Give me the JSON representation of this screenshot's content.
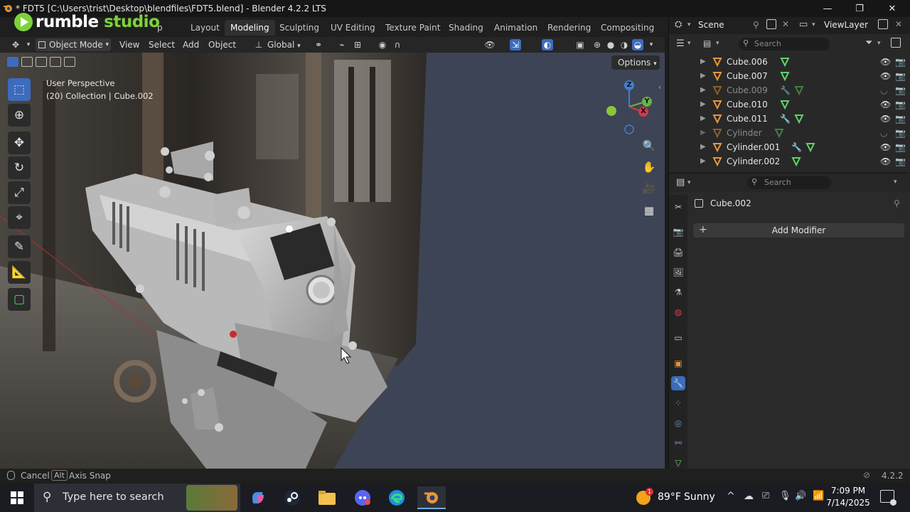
{
  "window": {
    "title": "* FDT5 [C:\\Users\\trist\\Desktop\\blendfiles\\FDT5.blend] - Blender 4.2.2 LTS",
    "minimize": "—",
    "maximize": "❐",
    "close": "✕"
  },
  "watermark": {
    "brand": "rumble",
    "suffix": "studio",
    "hidden_tab": "p"
  },
  "workspaces": [
    {
      "label": "Layout",
      "active": false
    },
    {
      "label": "Modeling",
      "active": true
    },
    {
      "label": "Sculpting",
      "active": false
    },
    {
      "label": "UV Editing",
      "active": false
    },
    {
      "label": "Texture Paint",
      "active": false
    },
    {
      "label": "Shading",
      "active": false
    },
    {
      "label": "Animation",
      "active": false
    },
    {
      "label": "Rendering",
      "active": false
    },
    {
      "label": "Compositing",
      "active": false
    }
  ],
  "scene": {
    "label": "Scene",
    "view_layer": "ViewLayer"
  },
  "viewport_header": {
    "mode": "Object Mode",
    "menus": [
      "View",
      "Select",
      "Add",
      "Object"
    ],
    "transform_orientation": "Global",
    "options_label": "Options"
  },
  "viewport": {
    "perspective": "User Perspective",
    "collection": "(20) Collection | Cube.002",
    "gizmo": {
      "x": "X",
      "y": "Y",
      "z": "Z"
    }
  },
  "outliner": {
    "search_placeholder": "Search",
    "rows": [
      {
        "name": "Cube.006",
        "dim": false,
        "visible": true
      },
      {
        "name": "Cube.007",
        "dim": false,
        "visible": true
      },
      {
        "name": "Cube.009",
        "dim": true,
        "visible": false
      },
      {
        "name": "Cube.010",
        "dim": false,
        "visible": true
      },
      {
        "name": "Cube.011",
        "dim": false,
        "visible": true
      },
      {
        "name": "Cylinder",
        "dim": true,
        "visible": false
      },
      {
        "name": "Cylinder.001",
        "dim": false,
        "visible": true
      },
      {
        "name": "Cylinder.002",
        "dim": false,
        "visible": true
      }
    ]
  },
  "properties": {
    "search_placeholder": "Search",
    "object_name": "Cube.002",
    "add_modifier": "Add Modifier"
  },
  "statusbar": {
    "cancel": "Cancel",
    "alt_key": "Alt",
    "axis_snap": "Axis Snap",
    "version": "4.2.2"
  },
  "taskbar": {
    "search_placeholder": "Type here to search",
    "weather_temp": "89°F",
    "weather_desc": "Sunny",
    "weather_badge": "1",
    "time": "7:09 PM",
    "date": "7/14/2025"
  },
  "colors": {
    "accent_blue": "#3d6bbd",
    "mesh_green": "#5fd16b",
    "object_orange": "#e8953a",
    "viewport_bg": "#3d4455",
    "rumble_green": "#7dd23a"
  }
}
